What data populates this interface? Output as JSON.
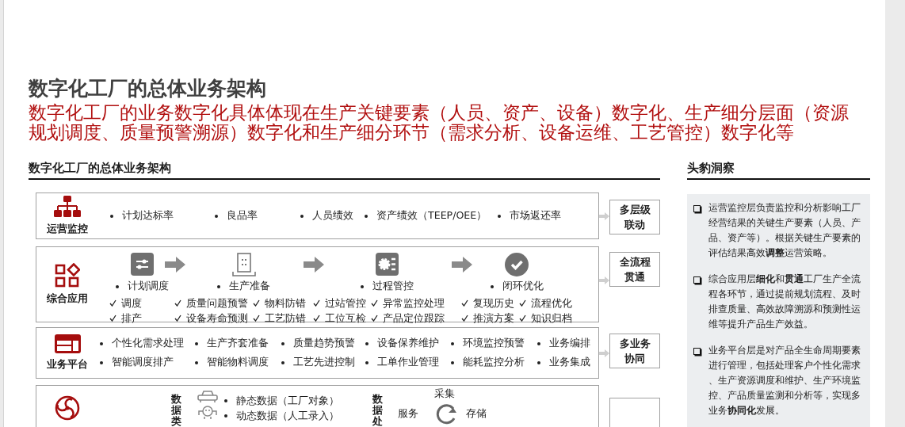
{
  "title": "数字化工厂的总体业务架构",
  "subtitle": "数字化工厂的业务数字化具体体现在生产关键要素（人员、资产、设备）数字化、生产细分层面（资源规划调度、质量预警溯源）数字化和生产细分环节（需求分析、设备运维、工艺管控）数字化等",
  "architecture": {
    "heading": "数字化工厂的总体业务架构",
    "layers": [
      {
        "kind": "metrics",
        "label": "运营监控",
        "items": [
          "计划达标率",
          "良品率",
          "人员绩效",
          "资产绩效（TEEP/OEE）",
          "市场返还率"
        ],
        "side": [
          "多层级",
          "联动"
        ]
      },
      {
        "kind": "flow",
        "label": "综合应用",
        "stages": [
          {
            "name": "计划调度",
            "checks": [
              [
                "调度",
                "排产"
              ]
            ]
          },
          {
            "name": "生产准备",
            "checks": [
              [
                "质量问题预警",
                "设备寿命预测"
              ],
              [
                "物料防错",
                "工艺防错"
              ]
            ]
          },
          {
            "name": "过程管控",
            "checks": [
              [
                "过站管控",
                "工位互检"
              ],
              [
                "异常监控处理",
                "产品定位跟踪"
              ]
            ]
          },
          {
            "name": "闭环优化",
            "checks": [
              [
                "复现历史",
                "推演方案"
              ],
              [
                "流程优化",
                "知识归档"
              ]
            ]
          }
        ],
        "side": [
          "全流程",
          "贯通"
        ]
      },
      {
        "kind": "grid",
        "label": "业务平台",
        "items": [
          "个性化需求处理",
          "生产齐套准备",
          "质量趋势预警",
          "设备保养维护",
          "环境监控预警",
          "业务编排",
          "智能调度排产",
          "智能物料调度",
          "工艺先进控制",
          "工单作业管理",
          "能耗监控分析",
          "业务集成"
        ],
        "side": [
          "多业务",
          "协同"
        ]
      },
      {
        "kind": "data",
        "types_label": "数据类",
        "types": [
          "静态数据（工厂对象）",
          "动态数据（人工录入）"
        ],
        "process_label": "数据处",
        "cycle": [
          "采集",
          "服务",
          "存储"
        ]
      }
    ]
  },
  "insight": {
    "heading": "头豹洞察",
    "points": [
      "运营监控层负责监控和分析影响工厂经营结果的关键生产要素（人员、产品、资产等）。根据关键生产要素的评估结果高效**调整**运营策略。",
      "综合应用层**细化**和**贯通**工厂生产全流程各环节，通过提前规划流程、及时排查质量、高效故障溯源和预测性运维等提升产品生产效益。",
      "业务平台层是对产品全生命周期要素进行管理，包括处理客户个性化需求、生产资源调度和维护、生产环境监控、产品质量监测和分析等，实现多业务**协同化**发展。"
    ]
  }
}
